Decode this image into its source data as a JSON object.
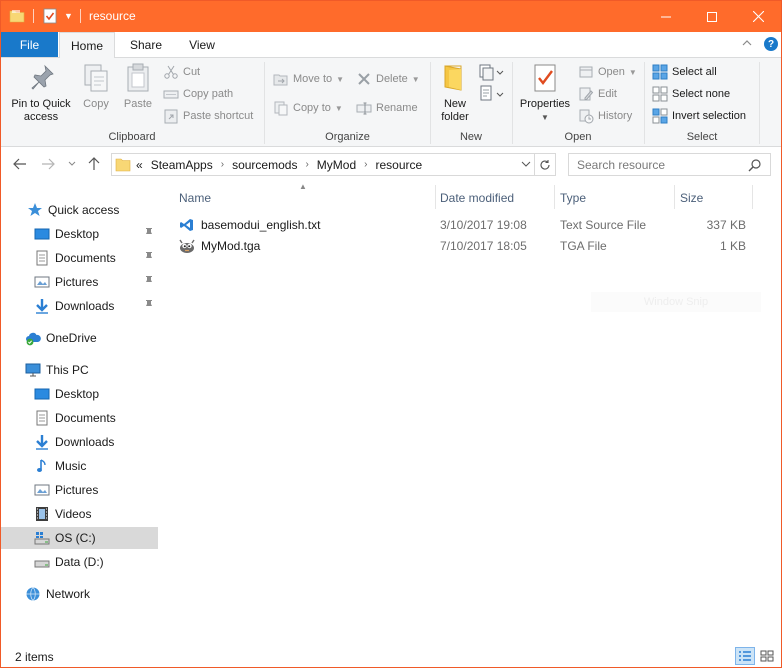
{
  "window": {
    "title": "resource",
    "accent": "#ff6b2b"
  },
  "tabs": {
    "file": "File",
    "home": "Home",
    "share": "Share",
    "view": "View",
    "help": "?"
  },
  "ribbon": {
    "clipboard": {
      "label": "Clipboard",
      "pin_line1": "Pin to Quick",
      "pin_line2": "access",
      "copy": "Copy",
      "paste": "Paste",
      "cut": "Cut",
      "copy_path": "Copy path",
      "paste_shortcut": "Paste shortcut"
    },
    "organize": {
      "label": "Organize",
      "move_to": "Move to",
      "copy_to": "Copy to",
      "delete": "Delete",
      "rename": "Rename"
    },
    "new": {
      "label": "New",
      "new_folder_line1": "New",
      "new_folder_line2": "folder"
    },
    "open": {
      "label": "Open",
      "properties": "Properties",
      "open": "Open",
      "edit": "Edit",
      "history": "History"
    },
    "select": {
      "label": "Select",
      "select_all": "Select all",
      "select_none": "Select none",
      "invert_selection": "Invert selection"
    }
  },
  "address": {
    "overflow": "«",
    "crumbs": [
      "SteamApps",
      "sourcemods",
      "MyMod",
      "resource"
    ]
  },
  "search": {
    "placeholder": "Search resource"
  },
  "nav": {
    "quick_access": "Quick access",
    "qa_items": [
      "Desktop",
      "Documents",
      "Pictures",
      "Downloads"
    ],
    "onedrive": "OneDrive",
    "this_pc": "This PC",
    "pc_items": [
      "Desktop",
      "Documents",
      "Downloads",
      "Music",
      "Pictures",
      "Videos",
      "OS (C:)",
      "Data (D:)"
    ],
    "network": "Network"
  },
  "columns": {
    "name": "Name",
    "date": "Date modified",
    "type": "Type",
    "size": "Size"
  },
  "files": [
    {
      "name": "basemodui_english.txt",
      "date": "3/10/2017 19:08",
      "type": "Text Source File",
      "size": "337 KB",
      "icon": "text-source-file-icon"
    },
    {
      "name": "MyMod.tga",
      "date": "7/10/2017 18:05",
      "type": "TGA File",
      "size": "1 KB",
      "icon": "gimp-image-icon"
    }
  ],
  "ghost_label": "Window Snip",
  "status": {
    "count": "2 items"
  }
}
